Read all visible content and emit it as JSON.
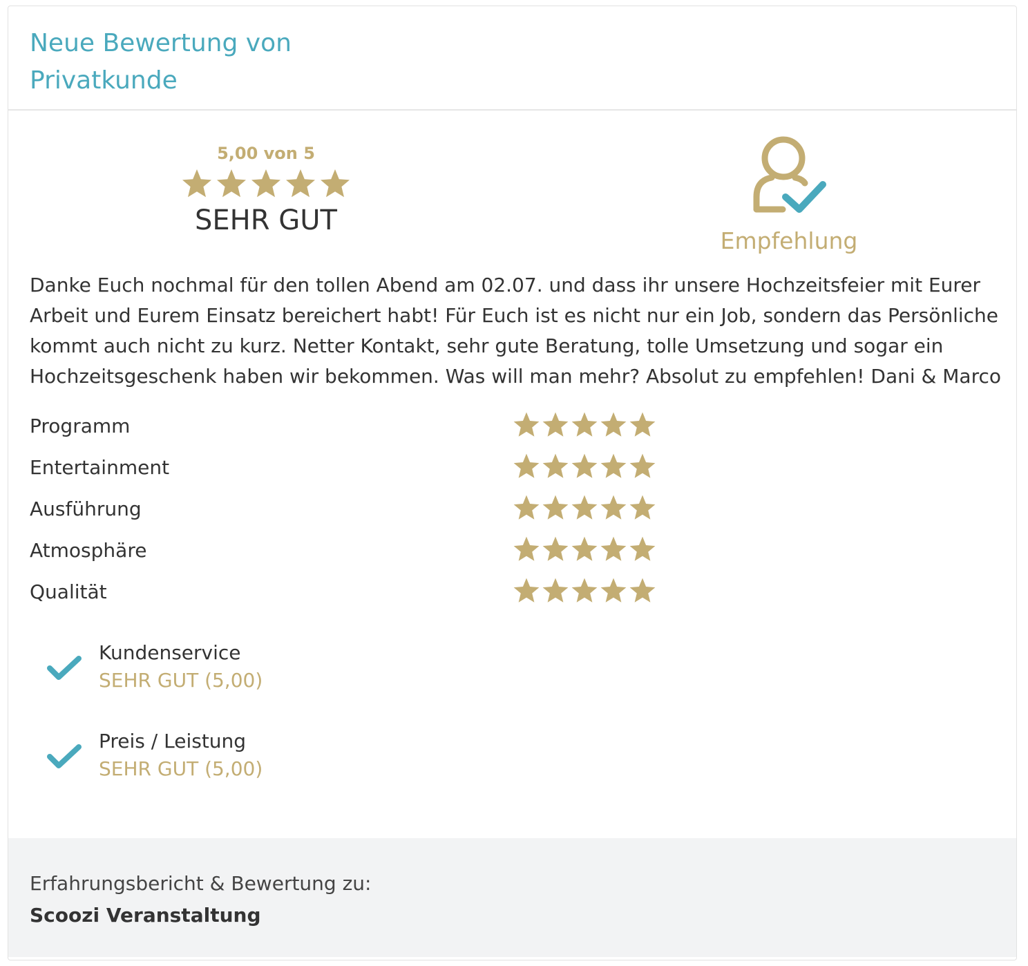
{
  "header": {
    "title_line1": "Neue Bewertung von",
    "title_line2": "Privatkunde"
  },
  "summary": {
    "score_text": "5,00 von 5",
    "stars": 5,
    "max_stars": 5,
    "verdict": "SEHR GUT"
  },
  "recommendation": {
    "icon": "user-check-icon",
    "label": "Empfehlung"
  },
  "review": {
    "text": "Danke Euch nochmal für den tollen Abend am 02.07. und dass ihr unsere Hochzeitsfeier mit Eurer Arbeit und Eurem Einsatz bereichert habt! Für Euch ist es nicht nur ein Job, sondern das Persönliche kommt auch nicht zu kurz. Netter Kontakt, sehr gute Beratung, tolle Umsetzung und sogar ein Hochzeitsgeschenk haben wir bekommen. Was will man mehr? Absolut zu empfehlen! Dani & Marco"
  },
  "criteria": [
    {
      "label": "Programm",
      "stars": 5
    },
    {
      "label": "Entertainment",
      "stars": 5
    },
    {
      "label": "Ausführung",
      "stars": 5
    },
    {
      "label": "Atmosphäre",
      "stars": 5
    },
    {
      "label": "Qualität",
      "stars": 5
    }
  ],
  "extras": [
    {
      "label": "Kundenservice",
      "value": "SEHR GUT (5,00)",
      "icon": "check-icon"
    },
    {
      "label": "Preis / Leistung",
      "value": "SEHR GUT (5,00)",
      "icon": "check-icon"
    }
  ],
  "footer": {
    "label": "Erfahrungsbericht & Bewertung zu:",
    "company": "Scoozi Veranstaltung"
  },
  "colors": {
    "accent_teal": "#4aa9bd",
    "gold": "#c3ad73",
    "text": "#333333",
    "footer_bg": "#f2f3f4"
  }
}
